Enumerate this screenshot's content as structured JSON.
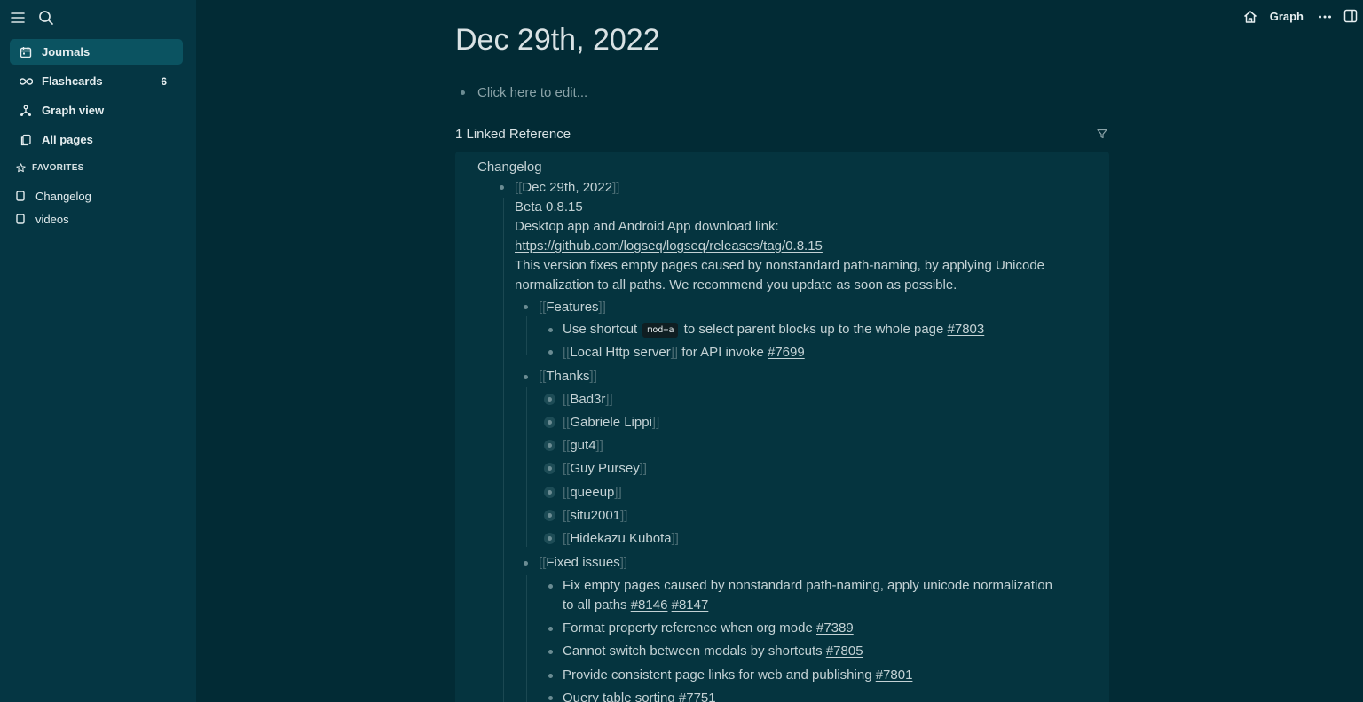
{
  "sidebar": {
    "nav": [
      {
        "label": "Journals",
        "icon": "calendar-icon",
        "active": true
      },
      {
        "label": "Flashcards",
        "icon": "infinity-icon",
        "count": "6"
      },
      {
        "label": "Graph view",
        "icon": "graph-icon"
      },
      {
        "label": "All pages",
        "icon": "pages-icon"
      }
    ],
    "favorites_label": "FAVORITES",
    "favorites": [
      {
        "label": "Changelog",
        "icon": "page-icon"
      },
      {
        "label": "videos",
        "icon": "page-icon"
      }
    ]
  },
  "header": {
    "graph_label": "Graph"
  },
  "page": {
    "title": "Dec 29th, 2022",
    "edit_placeholder": "Click here to edit...",
    "linked_refs_label": "1 Linked Reference"
  },
  "reference": {
    "page_name": "Changelog",
    "date_link": "Dec 29th, 2022",
    "lines": [
      "Beta 0.8.15",
      "Desktop app and Android App download link:",
      "https://github.com/logseq/logseq/releases/tag/0.8.15",
      "This version fixes empty pages caused by nonstandard path-naming, by applying Unicode",
      "normalization to all paths. We recommend you update as soon as possible."
    ],
    "features_label": "Features",
    "feature1_pre": "Use shortcut",
    "feature1_kbd": "mod+a",
    "feature1_post": "to select parent blocks up to the whole page",
    "feature1_tag": "#7803",
    "feature2_link": "Local Http server",
    "feature2_post": "for API invoke",
    "feature2_tag": "#7699",
    "thanks_label": "Thanks",
    "thanks": [
      "Bad3r",
      "Gabriele Lippi",
      "gut4",
      "Guy Pursey",
      "queeup",
      "situ2001",
      "Hidekazu Kubota"
    ],
    "fixed_label": "Fixed issues",
    "fix1_line1": "Fix empty pages caused by nonstandard path-naming, apply unicode normalization",
    "fix1_line2": "to all paths",
    "fix1_tag1": "#8146",
    "fix1_tag2": "#8147",
    "fix2_text": "Format property reference when org mode",
    "fix2_tag": "#7389",
    "fix3_text": "Cannot switch between modals by shortcuts",
    "fix3_tag": "#7805",
    "fix4_text": "Provide consistent page links for web and publishing",
    "fix4_tag": "#7801",
    "fix5_text": "Query table sorting",
    "fix5_tag": "#7751"
  }
}
